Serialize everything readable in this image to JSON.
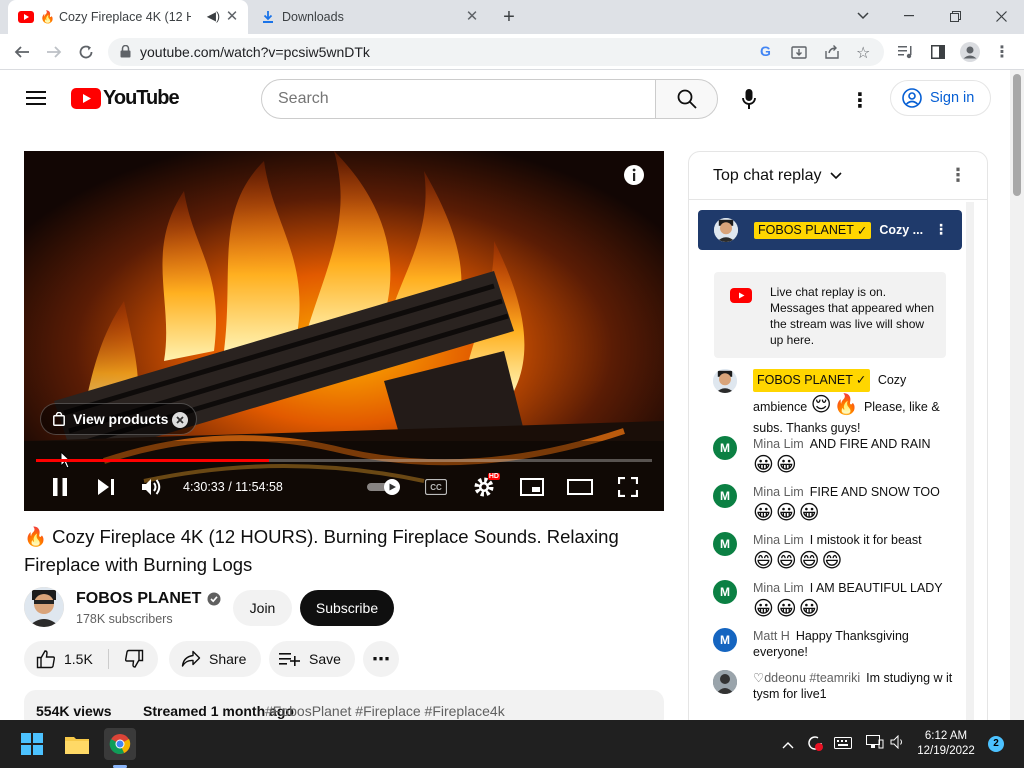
{
  "browser": {
    "tabs": [
      {
        "title": "Cozy Fireplace 4K (12 HC"
      },
      {
        "title": "Downloads"
      }
    ],
    "url": "youtube.com/watch?v=pcsiw5wnDTk"
  },
  "header": {
    "logo_text": "YouTube",
    "search_placeholder": "Search",
    "signin_label": "Sign in"
  },
  "player": {
    "time_current": "4:30:33",
    "time_sep": " / ",
    "time_total": "11:54:58",
    "progress_fraction": 0.378,
    "view_products_label": "View products",
    "hd_badge": "HD"
  },
  "video": {
    "title": "🔥 Cozy Fireplace 4K (12 HOURS). Burning Fireplace Sounds. Relaxing Fireplace with Burning Logs",
    "channel_name": "FOBOS PLANET",
    "subscribers": "178K subscribers",
    "join_label": "Join",
    "subscribe_label": "Subscribe",
    "likes": "1.5K",
    "share_label": "Share",
    "save_label": "Save",
    "views": "554K views",
    "streamed": "Streamed 1 month ago",
    "hashtags": "#FobosPlanet #Fireplace #Fireplace4k"
  },
  "chat": {
    "header_label": "Top chat replay",
    "pinned_author": "FOBOS PLANET",
    "pinned_text": "Cozy ...",
    "info_text": "Live chat replay is on. Messages that appeared when the stream was live will show up here.",
    "messages": [
      {
        "author": "FOBOS PLANET",
        "text_before": "Cozy ambience",
        "emojis": "😌🔥",
        "text_after": "Please, like & subs. Thanks guys!",
        "avatar_letter": "",
        "avatar_color": "#c58b5a"
      },
      {
        "author": "Mina Lim",
        "text": "AND FIRE AND RAIN",
        "emojis": "😀😀",
        "avatar_letter": "M",
        "avatar_color": "#0b8043"
      },
      {
        "author": "Mina Lim",
        "text": "FIRE AND SNOW TOO",
        "emojis": "😀😀😀",
        "avatar_letter": "M",
        "avatar_color": "#0b8043"
      },
      {
        "author": "Mina Lim",
        "text": "I mistook it for beast",
        "emojis": "😄😄😄😄",
        "avatar_letter": "M",
        "avatar_color": "#0b8043"
      },
      {
        "author": "Mina Lim",
        "text": "I AM BEAUTIFUL LADY",
        "emojis": "😀😀😀",
        "avatar_letter": "M",
        "avatar_color": "#0b8043"
      },
      {
        "author": "Matt H",
        "text": "Happy Thanksgiving everyone!",
        "emojis": "",
        "avatar_letter": "M",
        "avatar_color": "#1565c0"
      },
      {
        "author": "♡ddeonu #teamriki",
        "text": "Im studiyng w it tysm for live1",
        "emojis": "",
        "avatar_letter": "",
        "avatar_color": "#5b6770"
      }
    ]
  },
  "taskbar": {
    "time": "6:12 AM",
    "date": "12/19/2022",
    "notifications": "2"
  },
  "colors": {
    "yt_red": "#ff0000",
    "link_blue": "#065fd4",
    "owner_yellow": "#ffd600"
  }
}
